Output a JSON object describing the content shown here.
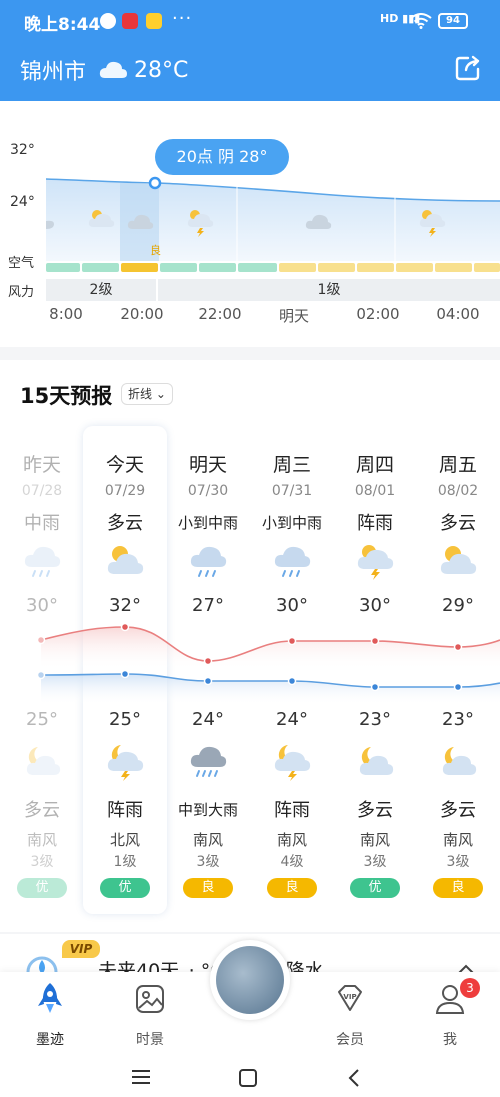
{
  "status": {
    "time": "晚上8:44",
    "network": "HD",
    "battery": "94"
  },
  "header": {
    "city": "锦州市",
    "weather_icon": "cloud-icon",
    "temp": "28°C"
  },
  "hourly": {
    "y_labels": [
      "32°",
      "24°"
    ],
    "tooltip": "20点 阴 28°",
    "air_label": "空气",
    "wind_label": "风力",
    "air_good": "良",
    "wind_segments": [
      "2级",
      "1级"
    ],
    "hours": [
      "8:00",
      "20:00",
      "22:00",
      "明天",
      "02:00",
      "04:00"
    ]
  },
  "forecast": {
    "title": "15天预报",
    "mode": "折线",
    "days": [
      {
        "day": "昨天",
        "date": "07/28",
        "wd": "中雨",
        "hi": "30°",
        "lo": "25°",
        "nd": "多云",
        "dir": "南风",
        "lv": "3级",
        "aq": "优",
        "aq_color": "#3ec48f",
        "icon_day": "rain",
        "icon_night": "moon-cloud"
      },
      {
        "day": "今天",
        "date": "07/29",
        "wd": "多云",
        "hi": "32°",
        "lo": "25°",
        "nd": "阵雨",
        "dir": "北风",
        "lv": "1级",
        "aq": "优",
        "aq_color": "#3ec48f",
        "icon_day": "sun-cloud",
        "icon_night": "moon-storm"
      },
      {
        "day": "明天",
        "date": "07/30",
        "wd": "小到中雨",
        "hi": "27°",
        "lo": "24°",
        "nd": "中到大雨",
        "dir": "南风",
        "lv": "3级",
        "aq": "良",
        "aq_color": "#f5b800",
        "icon_day": "rain",
        "icon_night": "heavy-rain"
      },
      {
        "day": "周三",
        "date": "07/31",
        "wd": "小到中雨",
        "hi": "30°",
        "lo": "24°",
        "nd": "阵雨",
        "dir": "南风",
        "lv": "4级",
        "aq": "良",
        "aq_color": "#f5b800",
        "icon_day": "rain",
        "icon_night": "moon-storm"
      },
      {
        "day": "周四",
        "date": "08/01",
        "wd": "阵雨",
        "hi": "30°",
        "lo": "23°",
        "nd": "多云",
        "dir": "南风",
        "lv": "3级",
        "aq": "优",
        "aq_color": "#3ec48f",
        "icon_day": "sun-storm",
        "icon_night": "moon-cloud"
      },
      {
        "day": "周五",
        "date": "08/02",
        "wd": "多云",
        "hi": "29°",
        "lo": "23°",
        "nd": "多云",
        "dir": "南风",
        "lv": "3级",
        "aq": "良",
        "aq_color": "#f5b800",
        "icon_day": "sun-cloud",
        "icon_night": "moon-cloud"
      }
    ]
  },
  "vip": {
    "badge": "VIP",
    "text": "未来40天，·    °C，12天降水"
  },
  "nav": {
    "items": [
      {
        "label": "墨迹",
        "icon": "rocket-icon"
      },
      {
        "label": "时景",
        "icon": "picture-icon"
      },
      {
        "label": "会员",
        "icon": "vip-icon"
      },
      {
        "label": "我",
        "icon": "person-icon"
      }
    ],
    "badge_count": "3"
  }
}
